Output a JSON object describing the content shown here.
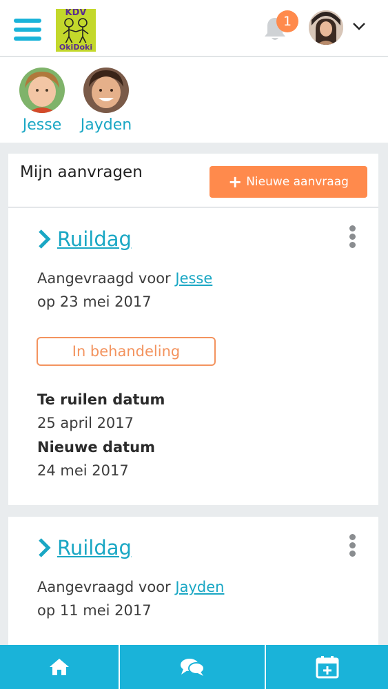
{
  "header": {
    "logo_top": "KDV",
    "logo_bottom": "OkiDoki",
    "notification_count": "1",
    "icons": {
      "menu": "hamburger-icon",
      "notifications": "bell-icon",
      "account_menu": "chevron-down-icon"
    }
  },
  "children": [
    {
      "name": "Jesse"
    },
    {
      "name": "Jayden"
    }
  ],
  "requests_panel": {
    "title": "Mijn aanvragen",
    "new_button_label": "Nieuwe aanvraag"
  },
  "cards": [
    {
      "title": "Ruildag",
      "requested_for_prefix": "Aangevraagd voor",
      "child": "Jesse",
      "date_line": "op 23 mei 2017",
      "status": "In behandeling",
      "swap_date_label": "Te ruilen datum",
      "swap_date": "25 april 2017",
      "new_date_label": "Nieuwe datum",
      "new_date": "24 mei 2017"
    },
    {
      "title": "Ruildag",
      "requested_for_prefix": "Aangevraagd voor",
      "child": "Jayden",
      "date_line": "op 11 mei 2017"
    }
  ],
  "bottom_nav": {
    "items": [
      "home-icon",
      "chat-icon",
      "calendar-add-icon"
    ]
  },
  "colors": {
    "accent": "#1ab3d9",
    "link": "#1aa7c4",
    "orange": "#ff8a4c",
    "logo_green": "#c3d82b"
  }
}
